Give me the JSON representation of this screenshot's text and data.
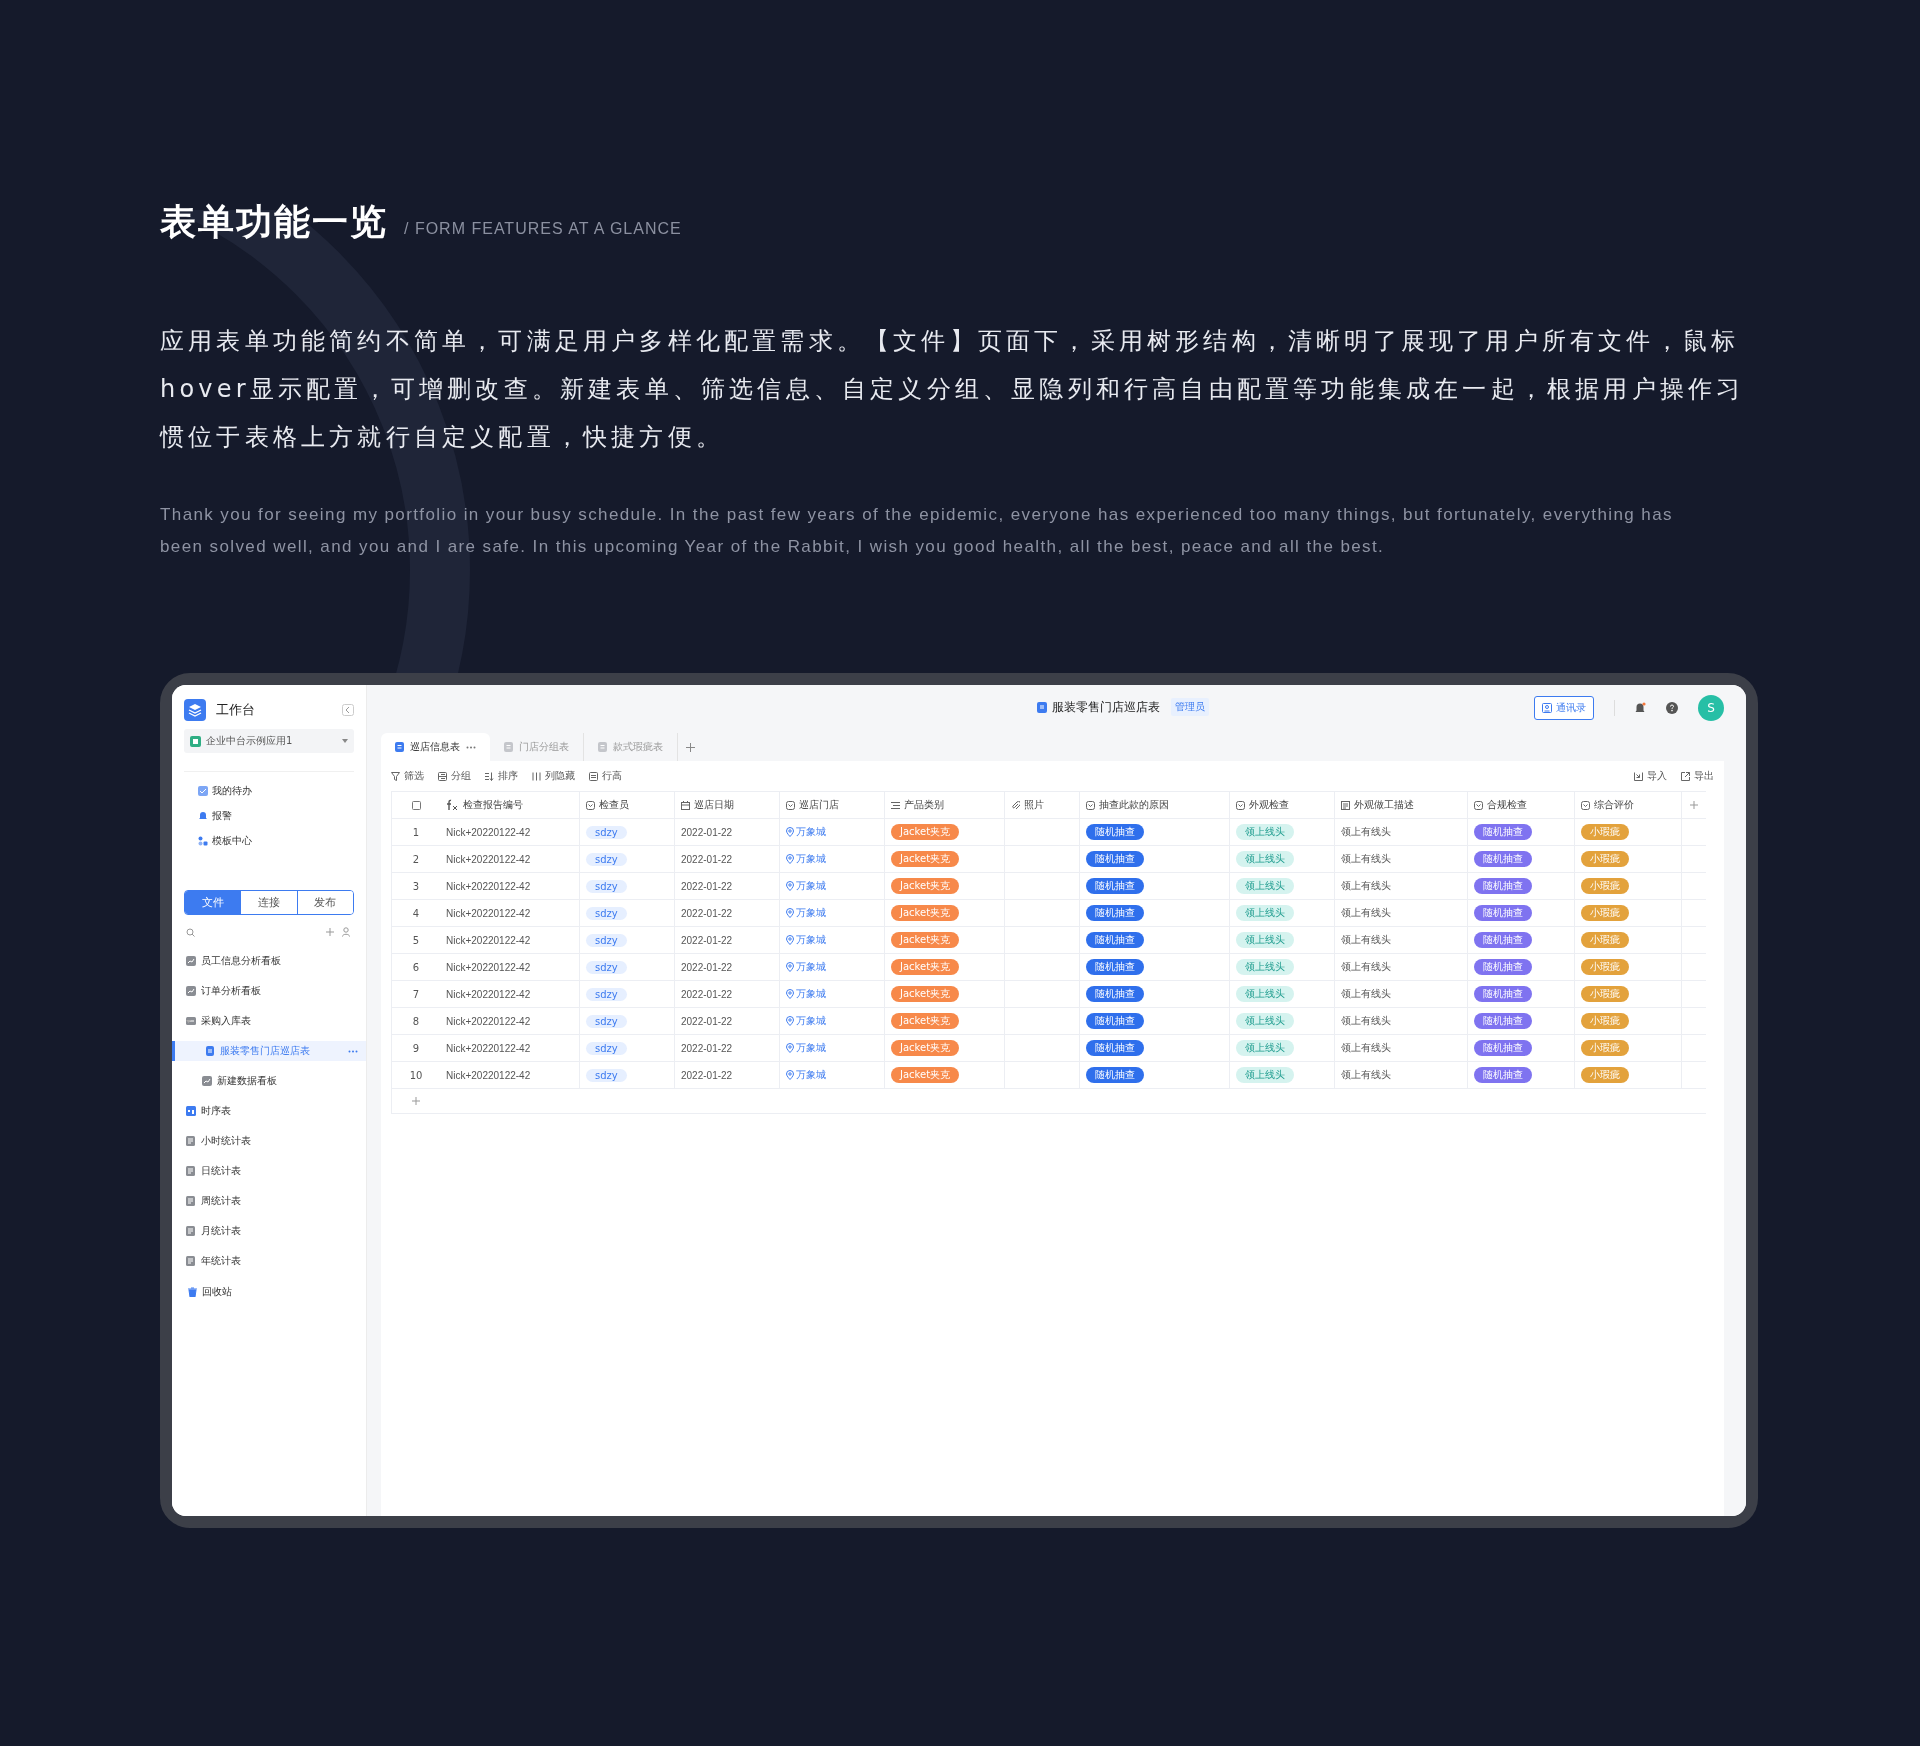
{
  "intro": {
    "title": "表单功能一览",
    "subtitle": "/ FORM FEATURES AT A GLANCE",
    "body_zh": "应用表单功能简约不简单，可满足用户多样化配置需求。【文件】页面下，采用树形结构，清晰明了展现了用户所有文件，鼠标hover显示配置，可增删改查。新建表单、筛选信息、自定义分组、显隐列和行高自由配置等功能集成在一起，根据用户操作习惯位于表格上方就行自定义配置，快捷方便。",
    "body_en": "Thank you for seeing my portfolio in your busy schedule. In the past few years of the epidemic, everyone has experienced too many things, but fortunately, everything has been solved well, and you and I are safe. In this upcoming Year of the Rabbit, I wish you good health, all the best, peace and all the best."
  },
  "app": {
    "sidebar": {
      "title": "工作台",
      "workspace": "企业中台示例应用1",
      "nav": [
        {
          "label": "我的待办",
          "kind": "todo"
        },
        {
          "label": "报警",
          "kind": "alarm"
        },
        {
          "label": "模板中心",
          "kind": "template"
        }
      ],
      "segments": [
        {
          "label": "文件",
          "selected": true
        },
        {
          "label": "连接",
          "selected": false
        },
        {
          "label": "发布",
          "selected": false
        }
      ],
      "files": [
        {
          "label": "员工信息分析看板",
          "kind": "board",
          "selected": false
        },
        {
          "label": "订单分析看板",
          "kind": "board",
          "selected": false
        },
        {
          "label": "采购入库表",
          "kind": "folder",
          "selected": false,
          "expanded": true,
          "children": [
            {
              "label": "服装零售门店巡店表",
              "kind": "sheet",
              "selected": true
            },
            {
              "label": "新建数据看板",
              "kind": "board",
              "selected": false
            }
          ]
        },
        {
          "label": "时序表",
          "kind": "timeline",
          "selected": false
        },
        {
          "label": "小时统计表",
          "kind": "stats",
          "selected": false
        },
        {
          "label": "日统计表",
          "kind": "stats",
          "selected": false
        },
        {
          "label": "周统计表",
          "kind": "stats",
          "selected": false
        },
        {
          "label": "月统计表",
          "kind": "stats",
          "selected": false
        },
        {
          "label": "年统计表",
          "kind": "stats",
          "selected": false
        }
      ],
      "trash": "回收站"
    },
    "header": {
      "doc_title": "服装零售门店巡店表",
      "role_badge": "管理员",
      "contacts_button": "通讯录",
      "avatar_letter": "S"
    },
    "tabs": [
      {
        "label": "巡店信息表",
        "selected": true
      },
      {
        "label": "门店分组表",
        "selected": false
      },
      {
        "label": "款式瑕疵表",
        "selected": false
      }
    ],
    "toolbar": [
      {
        "label": "筛选",
        "kind": "filter"
      },
      {
        "label": "分组",
        "kind": "group"
      },
      {
        "label": "排序",
        "kind": "sort"
      },
      {
        "label": "列隐藏",
        "kind": "columns"
      },
      {
        "label": "行高",
        "kind": "height"
      }
    ],
    "toolbar_right": [
      {
        "label": "导入",
        "kind": "import"
      },
      {
        "label": "导出",
        "kind": "export"
      }
    ],
    "table": {
      "columns": [
        {
          "label": "检查报告编号",
          "kind": "text"
        },
        {
          "label": "检查员",
          "kind": "soft-tag"
        },
        {
          "label": "巡店日期",
          "kind": "text"
        },
        {
          "label": "巡店门店",
          "kind": "location"
        },
        {
          "label": "产品类别",
          "kind": "tag",
          "color": "#f7894a"
        },
        {
          "label": "照片",
          "kind": "photo"
        },
        {
          "label": "抽查此款的原因",
          "kind": "tag",
          "color": "#2f6fec"
        },
        {
          "label": "外观检查",
          "kind": "soft-tag"
        },
        {
          "label": "外观做工描述",
          "kind": "text"
        },
        {
          "label": "合规检查",
          "kind": "tag",
          "color": "#7f73f0"
        },
        {
          "label": "综合评价",
          "kind": "tag",
          "color": "#e3a23c"
        }
      ],
      "rows": [
        {
          "number": "1",
          "cells": [
            "Nick+20220122-42",
            "sdzy",
            "2022-01-22",
            "万象城",
            "Jacket夹克",
            "",
            "随机抽查",
            "领上线头",
            "领上有线头",
            "随机抽查",
            "小瑕疵"
          ]
        },
        {
          "number": "2",
          "cells": [
            "Nick+20220122-42",
            "sdzy",
            "2022-01-22",
            "万象城",
            "Jacket夹克",
            "",
            "随机抽查",
            "领上线头",
            "领上有线头",
            "随机抽查",
            "小瑕疵"
          ]
        },
        {
          "number": "3",
          "cells": [
            "Nick+20220122-42",
            "sdzy",
            "2022-01-22",
            "万象城",
            "Jacket夹克",
            "",
            "随机抽查",
            "领上线头",
            "领上有线头",
            "随机抽查",
            "小瑕疵"
          ]
        },
        {
          "number": "4",
          "cells": [
            "Nick+20220122-42",
            "sdzy",
            "2022-01-22",
            "万象城",
            "Jacket夹克",
            "",
            "随机抽查",
            "领上线头",
            "领上有线头",
            "随机抽查",
            "小瑕疵"
          ]
        },
        {
          "number": "5",
          "cells": [
            "Nick+20220122-42",
            "sdzy",
            "2022-01-22",
            "万象城",
            "Jacket夹克",
            "",
            "随机抽查",
            "领上线头",
            "领上有线头",
            "随机抽查",
            "小瑕疵"
          ]
        },
        {
          "number": "6",
          "cells": [
            "Nick+20220122-42",
            "sdzy",
            "2022-01-22",
            "万象城",
            "Jacket夹克",
            "",
            "随机抽查",
            "领上线头",
            "领上有线头",
            "随机抽查",
            "小瑕疵"
          ]
        },
        {
          "number": "7",
          "cells": [
            "Nick+20220122-42",
            "sdzy",
            "2022-01-22",
            "万象城",
            "Jacket夹克",
            "",
            "随机抽查",
            "领上线头",
            "领上有线头",
            "随机抽查",
            "小瑕疵"
          ]
        },
        {
          "number": "8",
          "cells": [
            "Nick+20220122-42",
            "sdzy",
            "2022-01-22",
            "万象城",
            "Jacket夹克",
            "",
            "随机抽查",
            "领上线头",
            "领上有线头",
            "随机抽查",
            "小瑕疵"
          ]
        },
        {
          "number": "9",
          "cells": [
            "Nick+20220122-42",
            "sdzy",
            "2022-01-22",
            "万象城",
            "Jacket夹克",
            "",
            "随机抽查",
            "领上线头",
            "领上有线头",
            "随机抽查",
            "小瑕疵"
          ]
        },
        {
          "number": "10",
          "cells": [
            "Nick+20220122-42",
            "sdzy",
            "2022-01-22",
            "万象城",
            "Jacket夹克",
            "",
            "随机抽查",
            "领上线头",
            "领上有线头",
            "随机抽查",
            "小瑕疵"
          ]
        }
      ]
    }
  }
}
